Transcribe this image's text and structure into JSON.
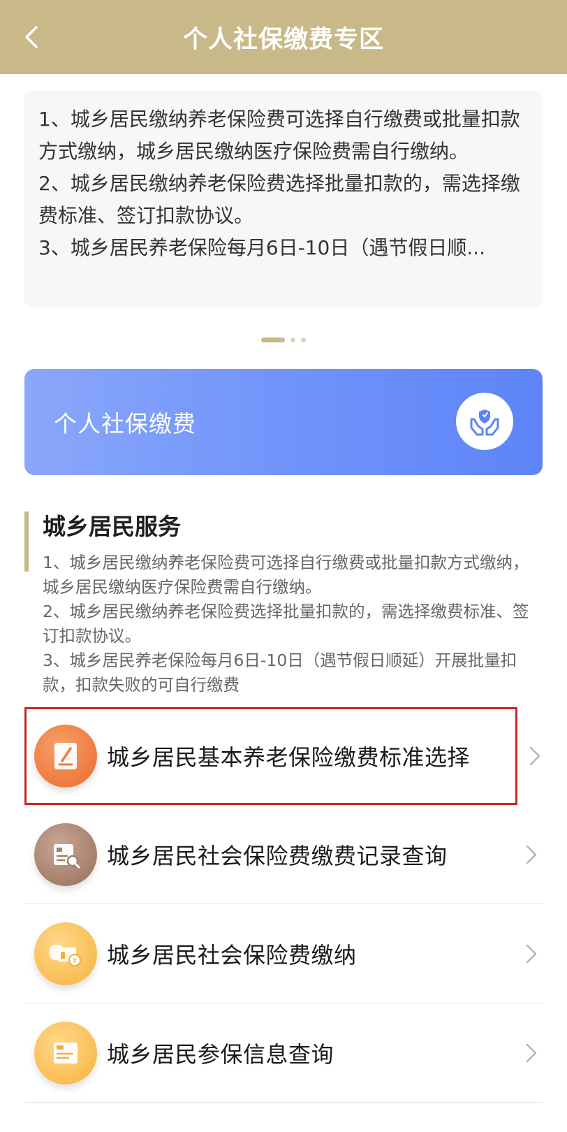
{
  "header": {
    "title": "个人社保缴费专区"
  },
  "notice": {
    "lines": [
      "1、城乡居民缴纳养老保险费可选择自行缴费或批量扣款方式缴纳，城乡居民缴纳医疗保险费需自行缴纳。",
      "2、城乡居民缴纳养老保险费选择批量扣款的，需选择缴费标准、签订扣款协议。",
      "3、城乡居民养老保险每月6日-10日（遇节假日顺..."
    ]
  },
  "carousel": {
    "page_count": 3,
    "active_index": 0
  },
  "banner": {
    "label": "个人社保缴费",
    "icon": "hands-shield-icon"
  },
  "section": {
    "title": "城乡居民服务",
    "desc": [
      "1、城乡居民缴纳养老保险费可选择自行缴费或批量扣款方式缴纳，城乡居民缴纳医疗保险费需自行缴纳。",
      "2、城乡居民缴纳养老保险费选择批量扣款的，需选择缴费标准、签订扣款协议。",
      "3、城乡居民养老保险每月6日-10日（遇节假日顺延）开展批量扣款，扣款失败的可自行缴费"
    ]
  },
  "services": [
    {
      "label": "城乡居民基本养老保险缴费标准选择",
      "icon": "edit-document-icon",
      "highlighted": true
    },
    {
      "label": "城乡居民社会保险费缴费记录查询",
      "icon": "record-search-icon",
      "highlighted": false
    },
    {
      "label": "城乡居民社会保险费缴纳",
      "icon": "payment-icon",
      "highlighted": false
    },
    {
      "label": "城乡居民参保信息查询",
      "icon": "info-card-icon",
      "highlighted": false
    }
  ],
  "colors": {
    "header_bg": "#c9b888",
    "banner_start": "#8aa7fa",
    "banner_end": "#5d84f7",
    "highlight_border": "#c62828"
  }
}
